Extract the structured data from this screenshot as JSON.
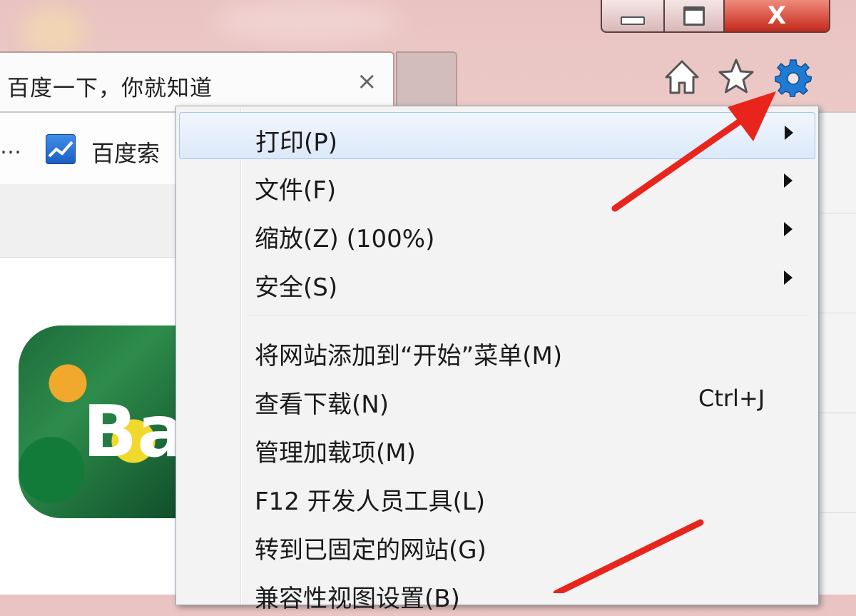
{
  "window": {
    "caption_buttons": [
      "minimize",
      "maximize",
      "close"
    ],
    "close_glyph": "X"
  },
  "tab": {
    "title": "百度一下，你就知道",
    "close_glyph": "×"
  },
  "toolbar_icons": [
    "home-icon",
    "star-icon",
    "gear-icon"
  ],
  "favorites_bar": {
    "overflow_text": "…",
    "item_label": "百度索"
  },
  "page": {
    "doodle_text": "Ba"
  },
  "menu": {
    "items": [
      {
        "label": "打印(P)",
        "submenu": true,
        "highlighted": true
      },
      {
        "label": "文件(F)",
        "submenu": true
      },
      {
        "label": "缩放(Z) (100%)",
        "submenu": true
      },
      {
        "label": "安全(S)",
        "submenu": true
      },
      {
        "label": "将网站添加到“开始”菜单(M)"
      },
      {
        "label": "查看下载(N)",
        "shortcut": "Ctrl+J"
      },
      {
        "label": "管理加载项(M)"
      },
      {
        "label": "F12 开发人员工具(L)"
      },
      {
        "label": "转到已固定的网站(G)"
      },
      {
        "label": "兼容性视图设置(B)"
      }
    ]
  },
  "colors": {
    "annotation_arrow": "#e8251c",
    "gear": "#1f7bd1",
    "menu_highlight": "#dce9fa"
  }
}
